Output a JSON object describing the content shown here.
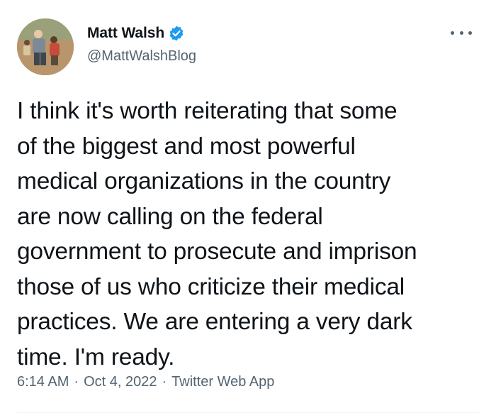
{
  "author": {
    "display_name": "Matt Walsh",
    "handle": "@MattWalshBlog",
    "verified": true,
    "verified_icon": "verified-badge-icon",
    "avatar_icon": "profile-photo"
  },
  "menu": {
    "icon": "more-options-icon"
  },
  "tweet": {
    "text": "I think it's worth reiterating that some\nof the biggest and most powerful\nmedical organizations in the country\nare now calling on the federal\ngovernment to prosecute and imprison\nthose of us who criticize their medical\npractices. We are entering a very dark\ntime. I'm ready.",
    "time": "6:14 AM",
    "date": "Oct 4, 2022",
    "source": "Twitter Web App",
    "separator": "·"
  },
  "colors": {
    "text_primary": "#0f1419",
    "text_secondary": "#536471",
    "verified_blue": "#1d9bf0",
    "divider": "#eff3f4"
  }
}
